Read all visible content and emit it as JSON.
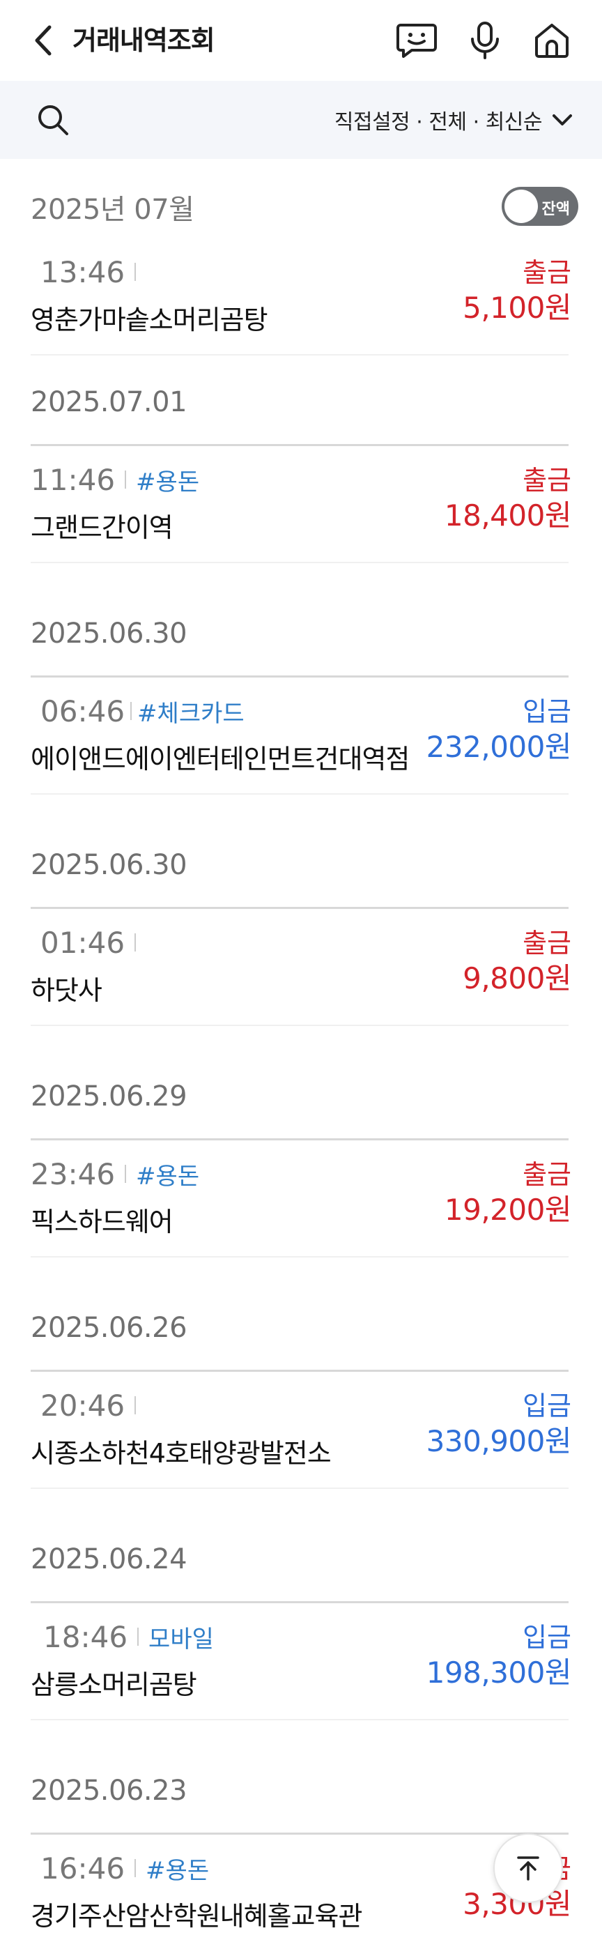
{
  "header": {
    "title": "거래내역조회",
    "icons": [
      "back-icon",
      "chatbot-icon",
      "microphone-icon",
      "home-icon"
    ]
  },
  "filter": {
    "label": "직접설정 · 전체 · 최신순",
    "icons": [
      "search-icon",
      "chevron-down-icon"
    ]
  },
  "month": {
    "label": "2025년 07월",
    "balance_toggle_label": "잔액",
    "balance_toggle_on": false
  },
  "first_transaction": {
    "time": "13:46",
    "tag": "",
    "merchant": "영춘가마솥소머리곰탕",
    "type": "출금",
    "amount": "5,100원",
    "direction": "out"
  },
  "groups": [
    {
      "date": "2025.07.01",
      "time": "11:46",
      "tag": "#용돈",
      "merchant": "그랜드간이역",
      "type": "출금",
      "amount": "18,400원",
      "direction": "out"
    },
    {
      "date": "2025.06.30",
      "time": "06:46",
      "tag": "#체크카드",
      "merchant": "에이앤드에이엔터테인먼트건대역점",
      "type": "입금",
      "amount": "232,000원",
      "direction": "in"
    },
    {
      "date": "2025.06.30",
      "time": "01:46",
      "tag": "",
      "merchant": "하닷사",
      "type": "출금",
      "amount": "9,800원",
      "direction": "out"
    },
    {
      "date": "2025.06.29",
      "time": "23:46",
      "tag": "#용돈",
      "merchant": "픽스하드웨어",
      "type": "출금",
      "amount": "19,200원",
      "direction": "out"
    },
    {
      "date": "2025.06.26",
      "time": "20:46",
      "tag": "",
      "merchant": "시종소하천4호태양광발전소",
      "type": "입금",
      "amount": "330,900원",
      "direction": "in"
    },
    {
      "date": "2025.06.24",
      "time": "18:46",
      "tag": "모바일",
      "merchant": "삼릉소머리곰탕",
      "type": "입금",
      "amount": "198,300원",
      "direction": "in"
    },
    {
      "date": "2025.06.23",
      "time": "16:46",
      "tag": "#용돈",
      "merchant": "경기주산암산학원내혜홀교육관",
      "type": "출금",
      "amount": "3,300원",
      "direction": "out"
    }
  ],
  "scroll_top_icon": "arrow-up-icon",
  "colors": {
    "out": "#d3232a",
    "in": "#2f6fd8",
    "tag": "#2f7ec8",
    "filter_bg": "#f4f6fa"
  }
}
